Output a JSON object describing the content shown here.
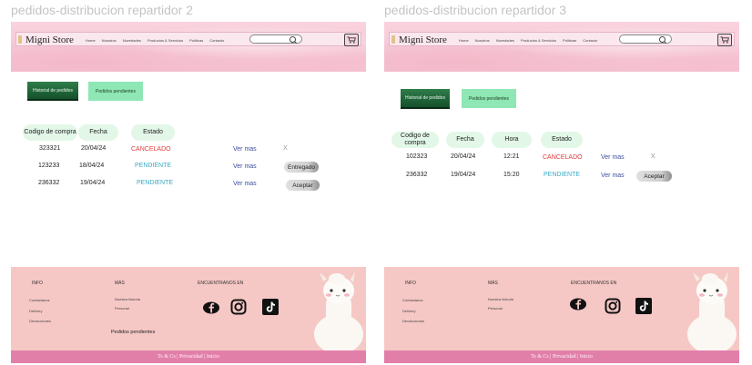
{
  "frames": [
    {
      "title": "pedidos-distribucion repartidor 2",
      "header": {
        "brand": "Migni Store",
        "nav": [
          "Home",
          "Nosotros",
          "Novedades",
          "Productos & Servicios",
          "Políticas",
          "Contacto"
        ]
      },
      "tabs": {
        "historial": "Historial de pedidos",
        "pendientes": "Pedidos pendientes"
      },
      "table": {
        "headers": [
          "Codigo de compra",
          "Fecha",
          "Estado"
        ],
        "rows": [
          {
            "code": "323321",
            "date": "20/04/24",
            "status": "CANCELADO",
            "link": "Ver mas",
            "action": "X"
          },
          {
            "code": "123233",
            "date": "18/04/24",
            "status": "PENDIENTE",
            "link": "Ver mas",
            "action": "Entregado"
          },
          {
            "code": "236332",
            "date": "19/04/24",
            "status": "PENDIENTE",
            "link": "Ver mas",
            "action": "Aceptar"
          }
        ]
      },
      "footer": {
        "info_title": "INFO",
        "info_items": [
          "Contactanos",
          "Delivery",
          "Devoluciones"
        ],
        "mas_title": "MÁS",
        "mas_items": [
          "Nuestra historia",
          "Personal"
        ],
        "social_title": "ENCUENTRANOS EN",
        "pending_label": "Pedidos pendientes",
        "bottom": "Ts & Cs | Privacidad | Inicio"
      }
    },
    {
      "title": "pedidos-distribucion repartidor 3",
      "header": {
        "brand": "Migni Store",
        "nav": [
          "Home",
          "Nosotros",
          "Novedades",
          "Productos & Servicios",
          "Políticas",
          "Contacto"
        ]
      },
      "tabs": {
        "historial": "Historial de pedidos",
        "pendientes": "Pedidos pendientes"
      },
      "table": {
        "headers": [
          "Codigo de compra",
          "Fecha",
          "Hora",
          "Estado"
        ],
        "rows": [
          {
            "code": "102323",
            "date": "20/04/24",
            "time": "12:21",
            "status": "CANCELADO",
            "link": "Ver mas",
            "action": "X"
          },
          {
            "code": "236332",
            "date": "19/04/24",
            "time": "15:20",
            "status": "PENDIENTE",
            "link": "Ver mas",
            "action": "Aceptar"
          }
        ]
      },
      "footer": {
        "info_title": "INFO",
        "info_items": [
          "Contactanos",
          "Delivery",
          "Devoluciones"
        ],
        "mas_title": "MÁS",
        "mas_items": [
          "Nuestra historia",
          "Personal"
        ],
        "social_title": "ENCUENTRANOS EN",
        "bottom": "Ts & Cs | Privacidad | Inicio"
      }
    }
  ],
  "colors": {
    "accent_dark_green": "#15512b",
    "accent_light_green": "#8ee7b4",
    "cancel_red": "#e23b3b",
    "pending_teal": "#3aa9c4",
    "footer_pink": "#f6c8c5",
    "footer_bar": "#e27fa9"
  },
  "icons": [
    "search-icon",
    "cart-icon",
    "facebook-icon",
    "instagram-icon",
    "tiktok-icon",
    "alpaca-mascot"
  ]
}
